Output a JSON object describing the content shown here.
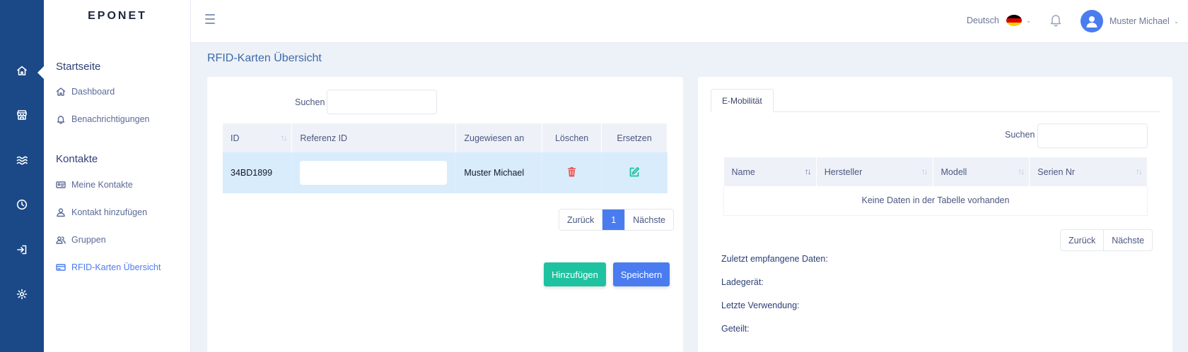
{
  "app": {
    "logo": "EPONET"
  },
  "rail": {
    "items": [
      "home-icon",
      "store-icon",
      "waves-icon",
      "clock-icon",
      "login-icon",
      "gear-icon"
    ]
  },
  "sidebar": {
    "groups": [
      {
        "title": "Startseite",
        "items": [
          {
            "label": "Dashboard",
            "icon": "home-icon"
          },
          {
            "label": "Benachrichtigungen",
            "icon": "bell-icon"
          }
        ]
      },
      {
        "title": "Kontakte",
        "items": [
          {
            "label": "Meine Kontakte",
            "icon": "id-card-icon"
          },
          {
            "label": "Kontakt hinzufügen",
            "icon": "user-icon"
          },
          {
            "label": "Gruppen",
            "icon": "users-icon"
          },
          {
            "label": "RFID-Karten Übersicht",
            "icon": "card-icon",
            "active": true
          }
        ]
      }
    ]
  },
  "topbar": {
    "language": "Deutsch",
    "flag_colors": [
      "#000000",
      "#dd0000",
      "#ffce00"
    ],
    "user_name": "Muster Michael"
  },
  "page": {
    "title": "RFID-Karten Übersicht"
  },
  "left": {
    "search_label": "Suchen",
    "search_value": "",
    "columns": [
      "ID",
      "Referenz ID",
      "Zugewiesen an",
      "Löschen",
      "Ersetzen"
    ],
    "rows": [
      {
        "id": "34BD1899",
        "referenz_id": "",
        "assigned_to": "Muster Michael"
      }
    ],
    "pager": {
      "prev": "Zurück",
      "current": "1",
      "next": "Nächste"
    },
    "buttons": {
      "add": "Hinzufügen",
      "save": "Speichern"
    }
  },
  "right": {
    "tab": "E-Mobilität",
    "search_label": "Suchen",
    "search_value": "",
    "columns": [
      "Name",
      "Hersteller",
      "Modell",
      "Serien Nr"
    ],
    "empty_text": "Keine Daten in der Tabelle vorhanden",
    "pager": {
      "prev": "Zurück",
      "next": "Nächste"
    },
    "info": [
      "Zuletzt empfangene Daten:",
      "Ladegerät:",
      "Letzte Verwendung:",
      "Geteilt:"
    ]
  },
  "colors": {
    "primary": "#4a7cf0",
    "success": "#1fc2a0",
    "rail": "#1b4886",
    "danger": "#ef4f4f"
  }
}
